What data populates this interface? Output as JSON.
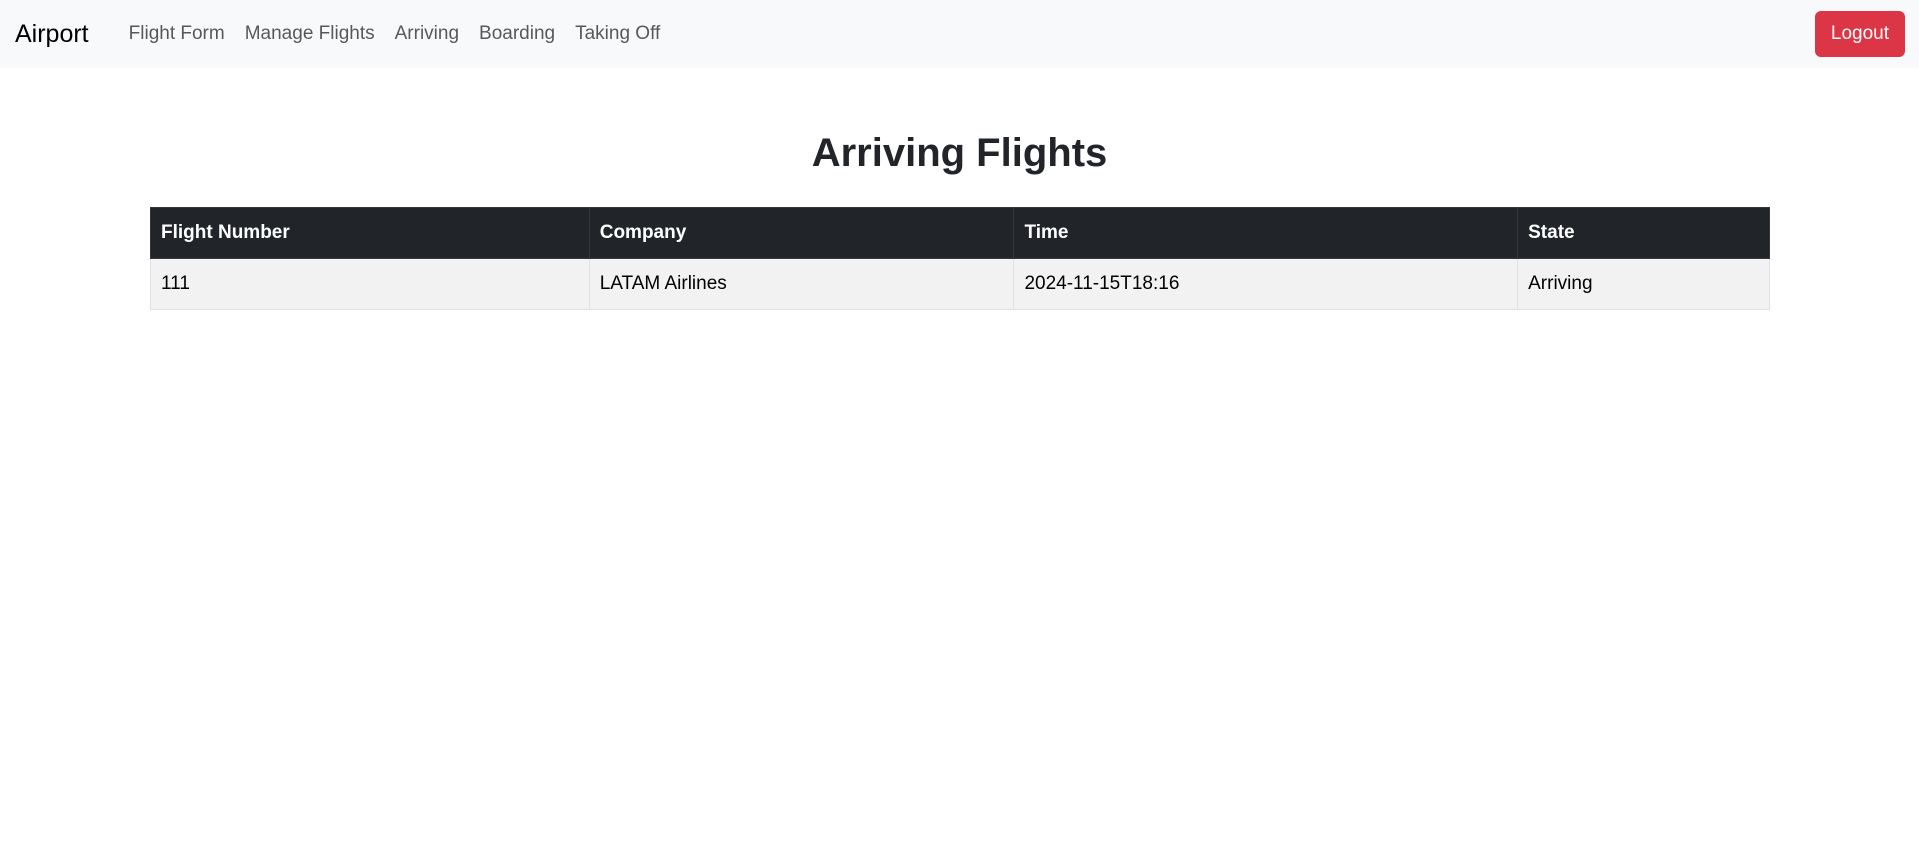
{
  "navbar": {
    "brand": "Airport",
    "links": [
      {
        "label": "Flight Form"
      },
      {
        "label": "Manage Flights"
      },
      {
        "label": "Arriving"
      },
      {
        "label": "Boarding"
      },
      {
        "label": "Taking Off"
      }
    ],
    "logout_label": "Logout"
  },
  "page": {
    "title": "Arriving Flights"
  },
  "table": {
    "headers": [
      "Flight Number",
      "Company",
      "Time",
      "State"
    ],
    "rows": [
      {
        "flight_number": "111",
        "company": "LATAM Airlines",
        "time": "2024-11-15T18:16",
        "state": "Arriving"
      }
    ]
  },
  "colors": {
    "navbar_bg": "#f8f9fa",
    "logout_bg": "#dc3545",
    "table_header_bg": "#212529",
    "row_bg": "#f2f2f2"
  }
}
